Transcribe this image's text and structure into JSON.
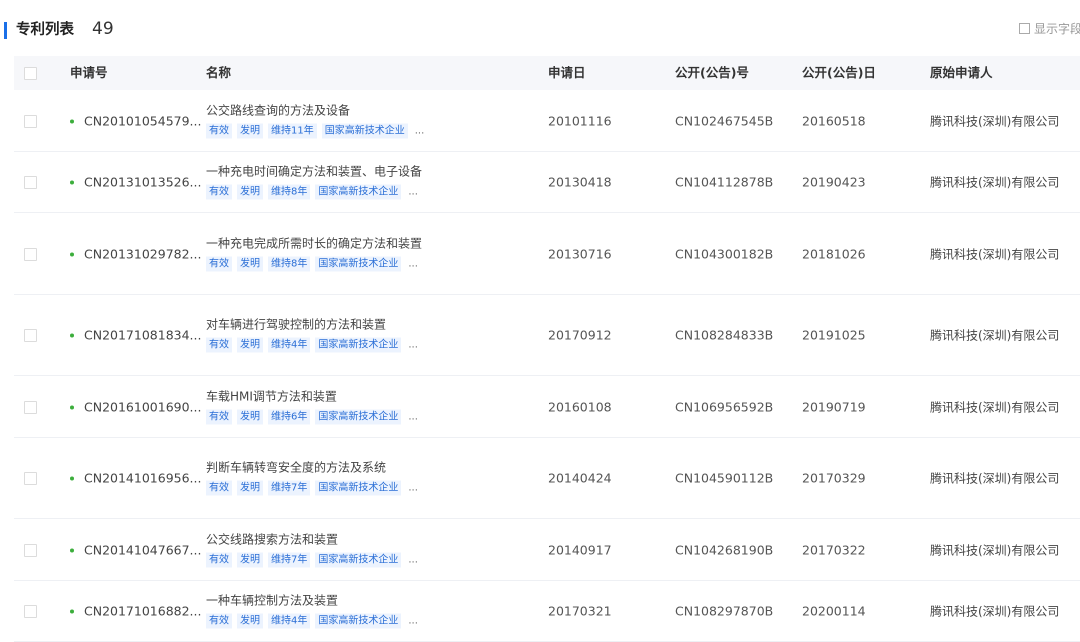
{
  "header": {
    "title": "专利列表",
    "count": "49",
    "show_fields": "显示字段"
  },
  "columns": {
    "app_no": "申请号",
    "name": "名称",
    "app_date": "申请日",
    "pub_no": "公开(公告)号",
    "pub_date": "公开(公告)日",
    "applicant": "原始申请人"
  },
  "rows": [
    {
      "app_no": "CN20101054579...",
      "name": "公交路线查询的方法及设备",
      "tags": [
        "有效",
        "发明",
        "维持11年",
        "国家高新技术企业"
      ],
      "more": "...",
      "app_date": "20101116",
      "pub_no": "CN102467545B",
      "pub_date": "20160518",
      "applicant": "腾讯科技(深圳)有限公司"
    },
    {
      "app_no": "CN20131013526...",
      "name": "一种充电时间确定方法和装置、电子设备",
      "tags": [
        "有效",
        "发明",
        "维持8年",
        "国家高新技术企业"
      ],
      "more": "...",
      "app_date": "20130418",
      "pub_no": "CN104112878B",
      "pub_date": "20190423",
      "applicant": "腾讯科技(深圳)有限公司"
    },
    {
      "app_no": "CN20131029782...",
      "name": "一种充电完成所需时长的确定方法和装置",
      "tags": [
        "有效",
        "发明",
        "维持8年",
        "国家高新技术企业"
      ],
      "more": "...",
      "app_date": "20130716",
      "pub_no": "CN104300182B",
      "pub_date": "20181026",
      "applicant": "腾讯科技(深圳)有限公司"
    },
    {
      "app_no": "CN20171081834...",
      "name": "对车辆进行驾驶控制的方法和装置",
      "tags": [
        "有效",
        "发明",
        "维持4年",
        "国家高新技术企业"
      ],
      "more": "...",
      "app_date": "20170912",
      "pub_no": "CN108284833B",
      "pub_date": "20191025",
      "applicant": "腾讯科技(深圳)有限公司"
    },
    {
      "app_no": "CN20161001690...",
      "name": "车载HMI调节方法和装置",
      "tags": [
        "有效",
        "发明",
        "维持6年",
        "国家高新技术企业"
      ],
      "more": "...",
      "app_date": "20160108",
      "pub_no": "CN106956592B",
      "pub_date": "20190719",
      "applicant": "腾讯科技(深圳)有限公司"
    },
    {
      "app_no": "CN20141016956...",
      "name": "判断车辆转弯安全度的方法及系统",
      "tags": [
        "有效",
        "发明",
        "维持7年",
        "国家高新技术企业"
      ],
      "more": "...",
      "app_date": "20140424",
      "pub_no": "CN104590112B",
      "pub_date": "20170329",
      "applicant": "腾讯科技(深圳)有限公司"
    },
    {
      "app_no": "CN20141047667...",
      "name": "公交线路搜索方法和装置",
      "tags": [
        "有效",
        "发明",
        "维持7年",
        "国家高新技术企业"
      ],
      "more": "...",
      "app_date": "20140917",
      "pub_no": "CN104268190B",
      "pub_date": "20170322",
      "applicant": "腾讯科技(深圳)有限公司"
    },
    {
      "app_no": "CN20171016882...",
      "name": "一种车辆控制方法及装置",
      "tags": [
        "有效",
        "发明",
        "维持4年",
        "国家高新技术企业"
      ],
      "more": "...",
      "app_date": "20170321",
      "pub_no": "CN108297870B",
      "pub_date": "20200114",
      "applicant": "腾讯科技(深圳)有限公司"
    }
  ]
}
